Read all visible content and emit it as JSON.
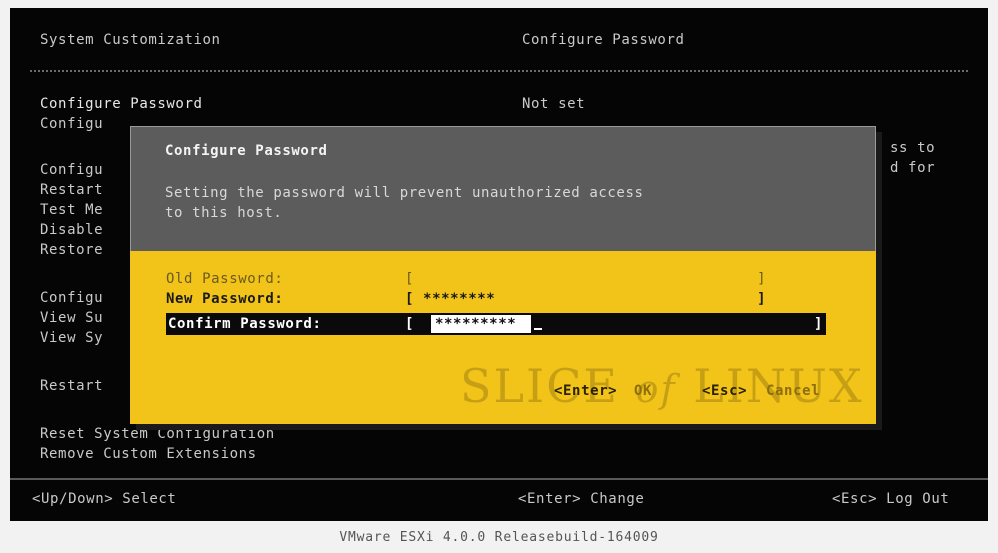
{
  "header": {
    "left_title": "System Customization",
    "right_title": "Configure Password"
  },
  "menu": {
    "items": [
      "Configure Password",
      "Configure Lockdown Mode",
      "Configure Management Network",
      "Restart Management Network",
      "Test Management Network",
      "Disable Management Network",
      "Restore Network Settings",
      "Configure Keyboard",
      "View Support Information",
      "View System Logs",
      "Restart Management Agents",
      "Reset System Configuration",
      "Remove Custom Extensions"
    ]
  },
  "menu_visible": {
    "configure_password": "Configure Password",
    "lockdown_partial": "Configu",
    "mgmt_partial": "Configu",
    "restart_partial": "Restart",
    "test_partial": "Test Me",
    "disable_partial": "Disable",
    "restore_partial": "Restore",
    "keyboard_partial": "Configu",
    "support_partial": "View Su",
    "logs_partial": "View Sy",
    "agents_partial": "Restart",
    "reset": "Reset System Configuration",
    "remove": "Remove Custom Extensions"
  },
  "right_panel": {
    "status": "Not set",
    "desc_line1_tail": "ss to",
    "desc_line2_tail": "d for"
  },
  "dialog": {
    "title": "Configure Password",
    "message_line1": "Setting the password will prevent unauthorized access",
    "message_line2": "to this host.",
    "old_password_label": "Old Password:",
    "old_password_value": "[                                      ]",
    "new_password_label": "New Password:",
    "new_password_value": "[ ********                             ]",
    "confirm_password_label": "Confirm Password:",
    "confirm_bracket_open": "[",
    "confirm_password_value": "*********",
    "confirm_bracket_close": "]",
    "ok_key": "<Enter>",
    "ok_label": "OK",
    "cancel_key": "<Esc>",
    "cancel_label": "Cancel"
  },
  "watermark": {
    "text_a": "SLICE ",
    "text_of": "of",
    "text_b": " LINUX"
  },
  "footer": {
    "select_hint": "<Up/Down> Select",
    "change_hint": "<Enter> Change",
    "logout_hint": "<Esc> Log Out"
  },
  "caption": "VMware ESXi 4.0.0 Releasebuild-164009",
  "colors": {
    "dialog_yellow": "#f2c319",
    "dialog_gray": "#5c5c5c",
    "screen_black": "#050505"
  }
}
